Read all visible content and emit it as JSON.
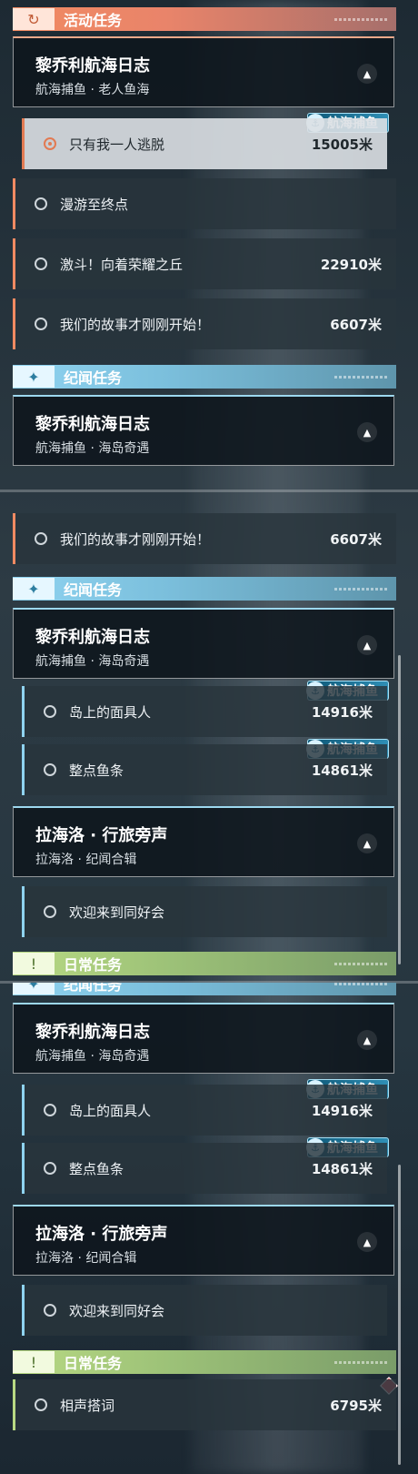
{
  "sections": {
    "activity": {
      "title": "活动任务",
      "icon": "refresh-icon"
    },
    "story": {
      "title": "纪闻任务",
      "icon": "sparkle-icon"
    },
    "daily": {
      "title": "日常任务",
      "icon": "exclamation-icon"
    }
  },
  "groups": {
    "lqlog_activity": {
      "title": "黎乔利航海日志",
      "subtitle": "航海捕鱼 · 老人鱼海"
    },
    "lqlog_story": {
      "title": "黎乔利航海日志",
      "subtitle": "航海捕鱼 · 海岛奇遇"
    },
    "lahailuo": {
      "title": "拉海洛 · 行旅旁声",
      "subtitle": "拉海洛 · 纪闻合辑"
    }
  },
  "quests": {
    "escape": {
      "name": "只有我一人逃脱",
      "distance": "15005米",
      "badge": "航海捕鱼"
    },
    "wander": {
      "name": "漫游至终点",
      "distance": ""
    },
    "glory": {
      "name": "激斗！向着荣耀之丘",
      "distance": "22910米"
    },
    "story_begin": {
      "name": "我们的故事才刚刚开始！",
      "distance": "6607米"
    },
    "mask": {
      "name": "岛上的面具人",
      "distance": "14916米",
      "badge": "航海捕鱼"
    },
    "fish": {
      "name": "整点鱼条",
      "distance": "14861米",
      "badge": "航海捕鱼"
    },
    "welcome": {
      "name": "欢迎来到同好会",
      "distance": ""
    },
    "crosstalk": {
      "name": "相声搭词",
      "distance": "6795米"
    }
  },
  "colors": {
    "activity": "#f18a62",
    "story": "#8fd3f0",
    "daily": "#b8d983",
    "alert": "#e2575e"
  }
}
